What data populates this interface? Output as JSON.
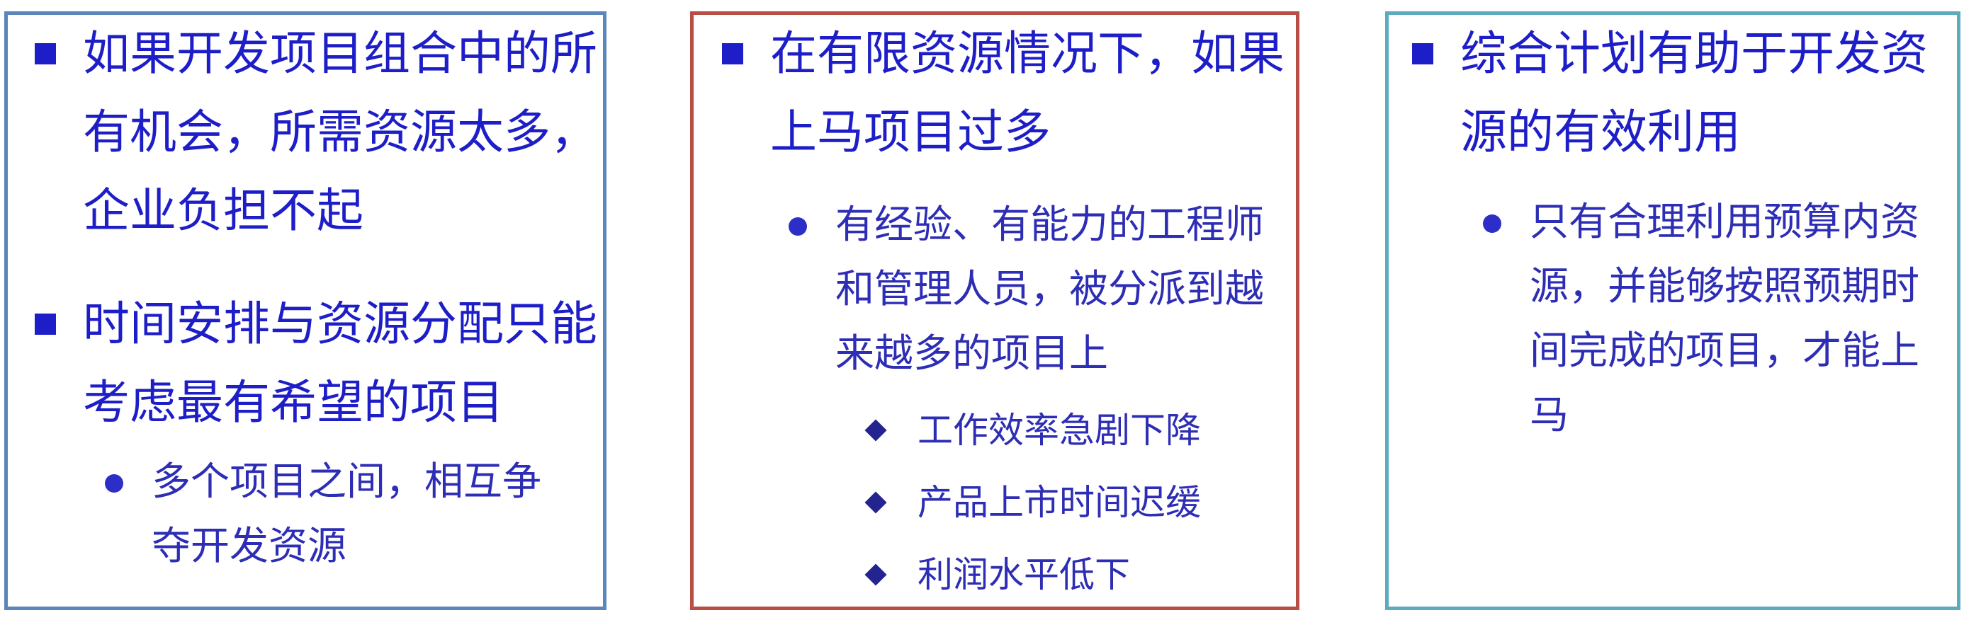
{
  "panels": [
    {
      "items": [
        {
          "level": 1,
          "text": "如果开发项目组合中的所有机会，所需资源太多，企业负担不起"
        },
        {
          "level": 1,
          "text": "时间安排与资源分配只能考虑最有希望的项目"
        },
        {
          "level": 2,
          "text": "多个项目之间，相互争夺开发资源"
        }
      ]
    },
    {
      "items": [
        {
          "level": 1,
          "text": "在有限资源情况下，如果上马项目过多"
        },
        {
          "level": 2,
          "text": "有经验、有能力的工程师和管理人员，被分派到越来越多的项目上"
        },
        {
          "level": 3,
          "text": "工作效率急剧下降"
        },
        {
          "level": 3,
          "text": "产品上市时间迟缓"
        },
        {
          "level": 3,
          "text": "利润水平低下"
        }
      ]
    },
    {
      "items": [
        {
          "level": 1,
          "text": "综合计划有助于开发资源的有效利用"
        },
        {
          "level": 2,
          "text": "只有合理利用预算内资源，并能够按照预期时间完成的项目，才能上马"
        }
      ]
    }
  ],
  "colors": {
    "text_primary": "#1e1ec8",
    "text_secondary": "#2d2db5",
    "border_panel_1": "#5b86ba",
    "border_panel_2": "#b94e44",
    "border_panel_3": "#5eabbd"
  },
  "icons": {
    "level_1_bullet": "square-bullet-icon",
    "level_2_bullet": "circle-bullet-icon",
    "level_3_bullet": "diamond-bullet-icon"
  }
}
